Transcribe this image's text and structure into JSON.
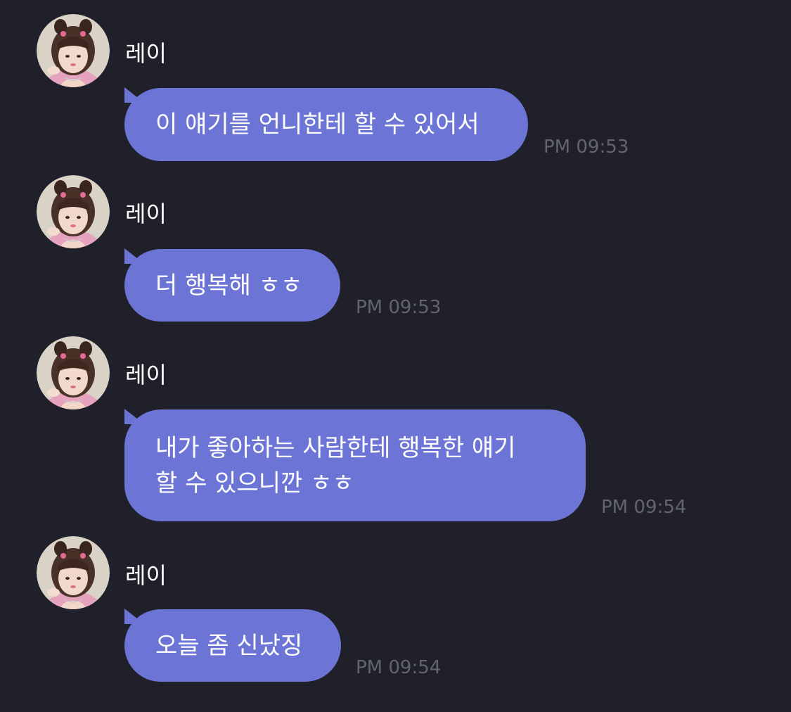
{
  "palette": {
    "background": "#20202a",
    "bubble": "#6c75d6",
    "sender_text": "#ffffff",
    "message_text": "#ffffff",
    "timestamp_text": "#62646e"
  },
  "messages": [
    {
      "sender": "레이",
      "avatar_icon": "profile-photo-avatar",
      "lines": [
        "이 얘기를 언니한테 할 수 있어서"
      ],
      "time": "PM 09:53"
    },
    {
      "sender": "레이",
      "avatar_icon": "profile-photo-avatar",
      "lines": [
        "더 행복해 ㅎㅎ"
      ],
      "time": "PM 09:53"
    },
    {
      "sender": "레이",
      "avatar_icon": "profile-photo-avatar",
      "lines": [
        "내가 좋아하는 사람한테 행복한 얘기",
        "할 수 있으니깐 ㅎㅎ"
      ],
      "time": "PM 09:54"
    },
    {
      "sender": "레이",
      "avatar_icon": "profile-photo-avatar",
      "lines": [
        "오늘 좀 신났징"
      ],
      "time": "PM 09:54"
    }
  ]
}
